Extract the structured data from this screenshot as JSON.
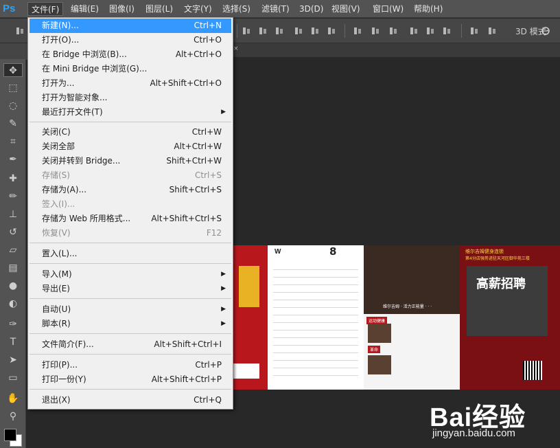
{
  "app": {
    "logo": "Ps"
  },
  "menubar": {
    "items": [
      "文件(F)",
      "编辑(E)",
      "图像(I)",
      "图层(L)",
      "文字(Y)",
      "选择(S)",
      "滤镜(T)",
      "3D(D)",
      "视图(V)",
      "窗口(W)",
      "帮助(H)"
    ],
    "active": "文件(F)"
  },
  "options_bar": {
    "mode_label": "3D 模式:"
  },
  "file_menu": {
    "items": [
      {
        "label": "新建(N)...",
        "shortcut": "Ctrl+N",
        "state": "highlighted"
      },
      {
        "label": "打开(O)...",
        "shortcut": "Ctrl+O"
      },
      {
        "label": "在 Bridge 中浏览(B)...",
        "shortcut": "Alt+Ctrl+O"
      },
      {
        "label": "在 Mini Bridge 中浏览(G)...",
        "shortcut": ""
      },
      {
        "label": "打开为...",
        "shortcut": "Alt+Shift+Ctrl+O"
      },
      {
        "label": "打开为智能对象...",
        "shortcut": ""
      },
      {
        "label": "最近打开文件(T)",
        "shortcut": "",
        "submenu": true
      },
      {
        "label": "关闭(C)",
        "shortcut": "Ctrl+W"
      },
      {
        "label": "关闭全部",
        "shortcut": "Alt+Ctrl+W"
      },
      {
        "label": "关闭并转到 Bridge...",
        "shortcut": "Shift+Ctrl+W"
      },
      {
        "label": "存储(S)",
        "shortcut": "Ctrl+S",
        "state": "disabled"
      },
      {
        "label": "存储为(A)...",
        "shortcut": "Shift+Ctrl+S"
      },
      {
        "label": "签入(I)...",
        "shortcut": "",
        "state": "disabled"
      },
      {
        "label": "存储为 Web 所用格式...",
        "shortcut": "Alt+Shift+Ctrl+S"
      },
      {
        "label": "恢复(V)",
        "shortcut": "F12",
        "state": "disabled"
      },
      {
        "label": "置入(L)...",
        "shortcut": ""
      },
      {
        "label": "导入(M)",
        "shortcut": "",
        "submenu": true
      },
      {
        "label": "导出(E)",
        "shortcut": "",
        "submenu": true
      },
      {
        "label": "自动(U)",
        "shortcut": "",
        "submenu": true
      },
      {
        "label": "脚本(R)",
        "shortcut": "",
        "submenu": true
      },
      {
        "label": "文件简介(F)...",
        "shortcut": "Alt+Shift+Ctrl+I"
      },
      {
        "label": "打印(P)...",
        "shortcut": "Ctrl+P"
      },
      {
        "label": "打印一份(Y)",
        "shortcut": "Alt+Shift+Ctrl+P"
      },
      {
        "label": "退出(X)",
        "shortcut": "Ctrl+Q"
      }
    ]
  },
  "tools": [
    "move-tool",
    "marquee-tool",
    "lasso-tool",
    "quick-select-tool",
    "crop-tool",
    "eyedropper-tool",
    "healing-brush-tool",
    "brush-tool",
    "clone-stamp-tool",
    "history-brush-tool",
    "eraser-tool",
    "gradient-tool",
    "blur-tool",
    "dodge-tool",
    "pen-tool",
    "type-tool",
    "path-select-tool",
    "shape-tool",
    "hand-tool",
    "zoom-tool"
  ],
  "colors": {
    "foreground": "#000000",
    "background": "#ffffff",
    "highlight": "#3399ff"
  },
  "document": {
    "texts": {
      "gym_name": "维尔吉姆健身连锁",
      "branch_line": "第4分店强势进驻天河区御华苑三楼",
      "hiring_title": "高薪招聘",
      "schedule_count": "8",
      "badge_1": "运动健康",
      "badge_2": "革命",
      "team_caption": "维尔吉姆 · 活力正能量 · · ·"
    }
  },
  "watermark": {
    "logo": "Bai经验",
    "url": "jingyan.baidu.com"
  }
}
